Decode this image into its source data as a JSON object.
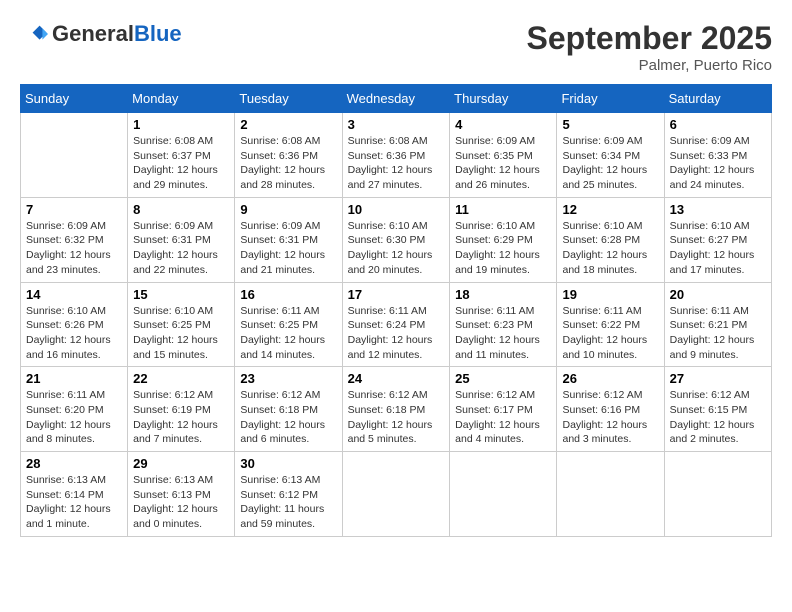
{
  "header": {
    "logo_general": "General",
    "logo_blue": "Blue",
    "title": "September 2025",
    "subtitle": "Palmer, Puerto Rico"
  },
  "days_of_week": [
    "Sunday",
    "Monday",
    "Tuesday",
    "Wednesday",
    "Thursday",
    "Friday",
    "Saturday"
  ],
  "weeks": [
    [
      {
        "day": "",
        "sunrise": "",
        "sunset": "",
        "daylight": ""
      },
      {
        "day": "1",
        "sunrise": "Sunrise: 6:08 AM",
        "sunset": "Sunset: 6:37 PM",
        "daylight": "Daylight: 12 hours and 29 minutes."
      },
      {
        "day": "2",
        "sunrise": "Sunrise: 6:08 AM",
        "sunset": "Sunset: 6:36 PM",
        "daylight": "Daylight: 12 hours and 28 minutes."
      },
      {
        "day": "3",
        "sunrise": "Sunrise: 6:08 AM",
        "sunset": "Sunset: 6:36 PM",
        "daylight": "Daylight: 12 hours and 27 minutes."
      },
      {
        "day": "4",
        "sunrise": "Sunrise: 6:09 AM",
        "sunset": "Sunset: 6:35 PM",
        "daylight": "Daylight: 12 hours and 26 minutes."
      },
      {
        "day": "5",
        "sunrise": "Sunrise: 6:09 AM",
        "sunset": "Sunset: 6:34 PM",
        "daylight": "Daylight: 12 hours and 25 minutes."
      },
      {
        "day": "6",
        "sunrise": "Sunrise: 6:09 AM",
        "sunset": "Sunset: 6:33 PM",
        "daylight": "Daylight: 12 hours and 24 minutes."
      }
    ],
    [
      {
        "day": "7",
        "sunrise": "Sunrise: 6:09 AM",
        "sunset": "Sunset: 6:32 PM",
        "daylight": "Daylight: 12 hours and 23 minutes."
      },
      {
        "day": "8",
        "sunrise": "Sunrise: 6:09 AM",
        "sunset": "Sunset: 6:31 PM",
        "daylight": "Daylight: 12 hours and 22 minutes."
      },
      {
        "day": "9",
        "sunrise": "Sunrise: 6:09 AM",
        "sunset": "Sunset: 6:31 PM",
        "daylight": "Daylight: 12 hours and 21 minutes."
      },
      {
        "day": "10",
        "sunrise": "Sunrise: 6:10 AM",
        "sunset": "Sunset: 6:30 PM",
        "daylight": "Daylight: 12 hours and 20 minutes."
      },
      {
        "day": "11",
        "sunrise": "Sunrise: 6:10 AM",
        "sunset": "Sunset: 6:29 PM",
        "daylight": "Daylight: 12 hours and 19 minutes."
      },
      {
        "day": "12",
        "sunrise": "Sunrise: 6:10 AM",
        "sunset": "Sunset: 6:28 PM",
        "daylight": "Daylight: 12 hours and 18 minutes."
      },
      {
        "day": "13",
        "sunrise": "Sunrise: 6:10 AM",
        "sunset": "Sunset: 6:27 PM",
        "daylight": "Daylight: 12 hours and 17 minutes."
      }
    ],
    [
      {
        "day": "14",
        "sunrise": "Sunrise: 6:10 AM",
        "sunset": "Sunset: 6:26 PM",
        "daylight": "Daylight: 12 hours and 16 minutes."
      },
      {
        "day": "15",
        "sunrise": "Sunrise: 6:10 AM",
        "sunset": "Sunset: 6:25 PM",
        "daylight": "Daylight: 12 hours and 15 minutes."
      },
      {
        "day": "16",
        "sunrise": "Sunrise: 6:11 AM",
        "sunset": "Sunset: 6:25 PM",
        "daylight": "Daylight: 12 hours and 14 minutes."
      },
      {
        "day": "17",
        "sunrise": "Sunrise: 6:11 AM",
        "sunset": "Sunset: 6:24 PM",
        "daylight": "Daylight: 12 hours and 12 minutes."
      },
      {
        "day": "18",
        "sunrise": "Sunrise: 6:11 AM",
        "sunset": "Sunset: 6:23 PM",
        "daylight": "Daylight: 12 hours and 11 minutes."
      },
      {
        "day": "19",
        "sunrise": "Sunrise: 6:11 AM",
        "sunset": "Sunset: 6:22 PM",
        "daylight": "Daylight: 12 hours and 10 minutes."
      },
      {
        "day": "20",
        "sunrise": "Sunrise: 6:11 AM",
        "sunset": "Sunset: 6:21 PM",
        "daylight": "Daylight: 12 hours and 9 minutes."
      }
    ],
    [
      {
        "day": "21",
        "sunrise": "Sunrise: 6:11 AM",
        "sunset": "Sunset: 6:20 PM",
        "daylight": "Daylight: 12 hours and 8 minutes."
      },
      {
        "day": "22",
        "sunrise": "Sunrise: 6:12 AM",
        "sunset": "Sunset: 6:19 PM",
        "daylight": "Daylight: 12 hours and 7 minutes."
      },
      {
        "day": "23",
        "sunrise": "Sunrise: 6:12 AM",
        "sunset": "Sunset: 6:18 PM",
        "daylight": "Daylight: 12 hours and 6 minutes."
      },
      {
        "day": "24",
        "sunrise": "Sunrise: 6:12 AM",
        "sunset": "Sunset: 6:18 PM",
        "daylight": "Daylight: 12 hours and 5 minutes."
      },
      {
        "day": "25",
        "sunrise": "Sunrise: 6:12 AM",
        "sunset": "Sunset: 6:17 PM",
        "daylight": "Daylight: 12 hours and 4 minutes."
      },
      {
        "day": "26",
        "sunrise": "Sunrise: 6:12 AM",
        "sunset": "Sunset: 6:16 PM",
        "daylight": "Daylight: 12 hours and 3 minutes."
      },
      {
        "day": "27",
        "sunrise": "Sunrise: 6:12 AM",
        "sunset": "Sunset: 6:15 PM",
        "daylight": "Daylight: 12 hours and 2 minutes."
      }
    ],
    [
      {
        "day": "28",
        "sunrise": "Sunrise: 6:13 AM",
        "sunset": "Sunset: 6:14 PM",
        "daylight": "Daylight: 12 hours and 1 minute."
      },
      {
        "day": "29",
        "sunrise": "Sunrise: 6:13 AM",
        "sunset": "Sunset: 6:13 PM",
        "daylight": "Daylight: 12 hours and 0 minutes."
      },
      {
        "day": "30",
        "sunrise": "Sunrise: 6:13 AM",
        "sunset": "Sunset: 6:12 PM",
        "daylight": "Daylight: 11 hours and 59 minutes."
      },
      {
        "day": "",
        "sunrise": "",
        "sunset": "",
        "daylight": ""
      },
      {
        "day": "",
        "sunrise": "",
        "sunset": "",
        "daylight": ""
      },
      {
        "day": "",
        "sunrise": "",
        "sunset": "",
        "daylight": ""
      },
      {
        "day": "",
        "sunrise": "",
        "sunset": "",
        "daylight": ""
      }
    ]
  ]
}
